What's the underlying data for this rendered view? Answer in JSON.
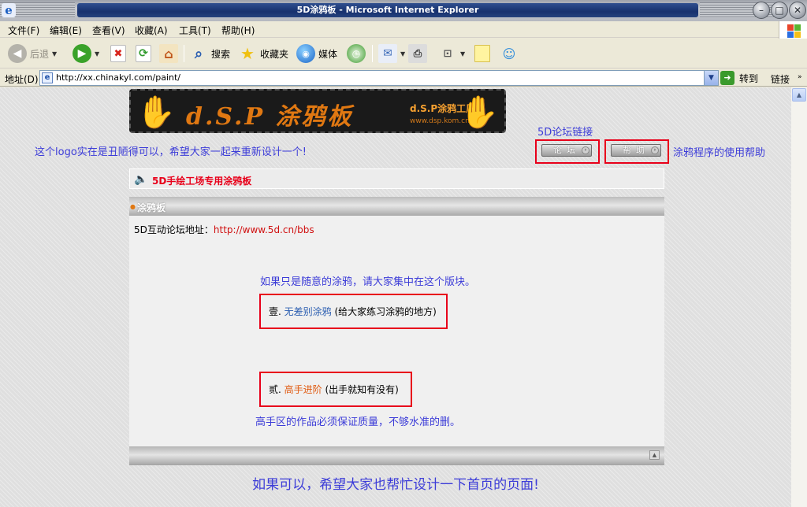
{
  "window": {
    "title": "5D涂鸦板 - Microsoft Internet Explorer",
    "ie_icon": "ie-logo-icon",
    "controls": [
      "minimize-icon",
      "maximize-icon",
      "close-icon"
    ]
  },
  "menu": {
    "file": "文件(F)",
    "edit": "编辑(E)",
    "view": "查看(V)",
    "favorites": "收藏(A)",
    "tools": "工具(T)",
    "help": "帮助(H)"
  },
  "toolbar": {
    "back": "后退",
    "search": "搜索",
    "favorites": "收藏夹",
    "media": "媒体"
  },
  "address": {
    "label": "地址(D)",
    "url": "http://xx.chinakyl.com/paint/",
    "go": "转到",
    "links": "链接"
  },
  "page": {
    "logo": {
      "brand": "d.S.P 涂鸦板",
      "subtitle": "d.S.P涂鸦工厂",
      "site": "www.dsp.kom.cn"
    },
    "logo_note": "这个logo实在是丑陋得可以，希望大家一起来重新设计一个!",
    "forum_link_label": "5D论坛链接",
    "forum_button": "论坛",
    "help_button": "帮助",
    "help_note": "涂鸦程序的使用帮助",
    "forum_title": "5D手绘工场专用涂鸦板",
    "board": {
      "header": "涂鸦板",
      "address_label": "5D互动论坛地址：",
      "address_url": "http://www.5d.cn/bbs",
      "note1": "如果只是随意的涂鸦，请大家集中在这个版块。",
      "item1_prefix": "壹.",
      "item1_link": "无差别涂鸦",
      "item1_desc": "(给大家练习涂鸦的地方)",
      "item2_prefix": "贰.",
      "item2_link": "高手进阶",
      "item2_desc": "(出手就知有没有)",
      "note2": "高手区的作品必须保证质量，不够水准的删。"
    },
    "bottom_note": "如果可以，希望大家也帮忙设计一下首页的页面!"
  },
  "colors": {
    "note_blue": "#3c3cd8",
    "highlight_red": "#e8001a",
    "link_blue": "#2a5db0",
    "link_orange": "#e05a10"
  }
}
